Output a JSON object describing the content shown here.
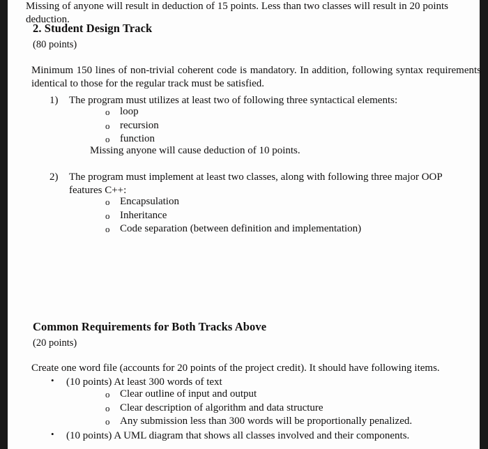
{
  "document": {
    "section1": {
      "title": "2. Student Design Track",
      "points": "(80 points)",
      "intro": "Minimum 150 lines of non-trivial coherent code is mandatory. In addition, following syntax requirements identical to those for the regular track must be satisfied.",
      "items": [
        {
          "marker": "1)",
          "text": "The program must utilizes at least two of following three syntactical elements:",
          "sub_bullet_glyph": "o",
          "sub_items": [
            "loop",
            "recursion",
            "function"
          ],
          "note": "Missing anyone will cause deduction of 10 points."
        },
        {
          "marker": "2)",
          "text": "The program must implement at least two classes, along with following three major OOP features C++:",
          "sub_bullet_glyph": "o",
          "sub_items": [
            "Encapsulation",
            "Inheritance",
            "Code separation (between definition and implementation)"
          ],
          "note": "Missing of anyone will result in deduction of 15 points. Less than two classes will result in 20 points deduction."
        }
      ]
    },
    "section2": {
      "title": "Common Requirements for Both Tracks Above",
      "points": "(20 points)",
      "intro": "Create one word file (accounts for 20 points of the project credit). It should have following items.",
      "bullet_glyph": "•",
      "sub_bullet_glyph": "o",
      "bullets": [
        {
          "text": "(10 points) At least 300 words of text",
          "sub_items": [
            "Clear outline of input and output",
            "Clear description of algorithm and data structure",
            "Any submission less than 300 words will be proportionally penalized."
          ]
        },
        {
          "text": "(10 points) A UML diagram that shows all classes involved and their components.",
          "sub_items": []
        }
      ]
    }
  },
  "colors": {
    "paper": "#fdfdfd",
    "text": "#100f0f",
    "edge_band": "#191919"
  }
}
